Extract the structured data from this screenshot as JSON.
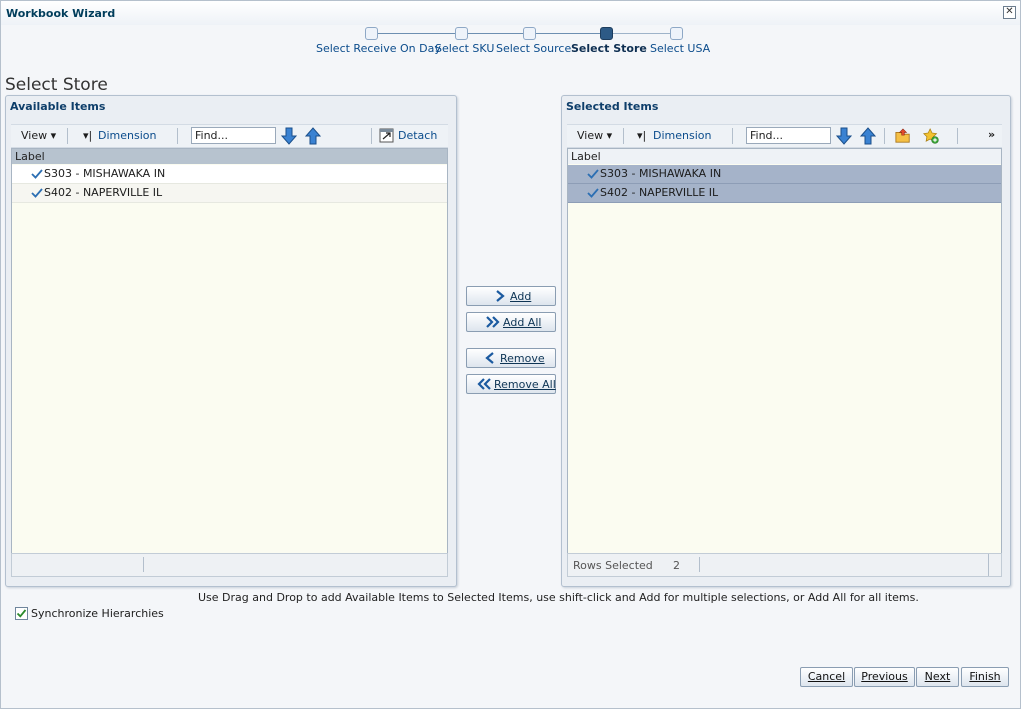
{
  "window": {
    "title": "Workbook Wizard",
    "close_icon": "close-icon"
  },
  "train": {
    "steps": [
      {
        "label": "Select Receive On Day",
        "active": false
      },
      {
        "label": "Select SKU",
        "active": false
      },
      {
        "label": "Select Source",
        "active": false
      },
      {
        "label": "Select Store",
        "active": true
      },
      {
        "label": "Select USA",
        "active": false
      }
    ]
  },
  "page_title": "Select Store",
  "available": {
    "title": "Available Items",
    "toolbar": {
      "view": "View",
      "dimension": "Dimension",
      "find_placeholder": "Find...",
      "detach": "Detach"
    },
    "column": "Label",
    "rows": [
      {
        "label": "S303 - MISHAWAKA IN"
      },
      {
        "label": "S402 - NAPERVILLE IL"
      }
    ]
  },
  "selected": {
    "title": "Selected Items",
    "toolbar": {
      "view": "View",
      "dimension": "Dimension",
      "find_placeholder": "Find...",
      "overflow": "»"
    },
    "column": "Label",
    "rows": [
      {
        "label": "S303 - MISHAWAKA IN"
      },
      {
        "label": "S402 - NAPERVILLE IL"
      }
    ],
    "status": {
      "label": "Rows Selected",
      "count": "2"
    }
  },
  "shuttle": {
    "add": "Add",
    "add_all": "Add All",
    "remove": "Remove",
    "remove_all": "Remove All"
  },
  "hint": "Use Drag and Drop to add Available Items to Selected Items, use shift-click and Add for multiple selections, or Add All for all items.",
  "sync": {
    "label": "Synchronize Hierarchies",
    "checked": true
  },
  "nav": {
    "cancel": "Cancel",
    "previous": "Previous",
    "next": "Next",
    "finish": "Finish"
  },
  "colors": {
    "accent": "#0b4c8c",
    "selected_row": "#a5b3c9",
    "header": "#b7c3cf"
  }
}
